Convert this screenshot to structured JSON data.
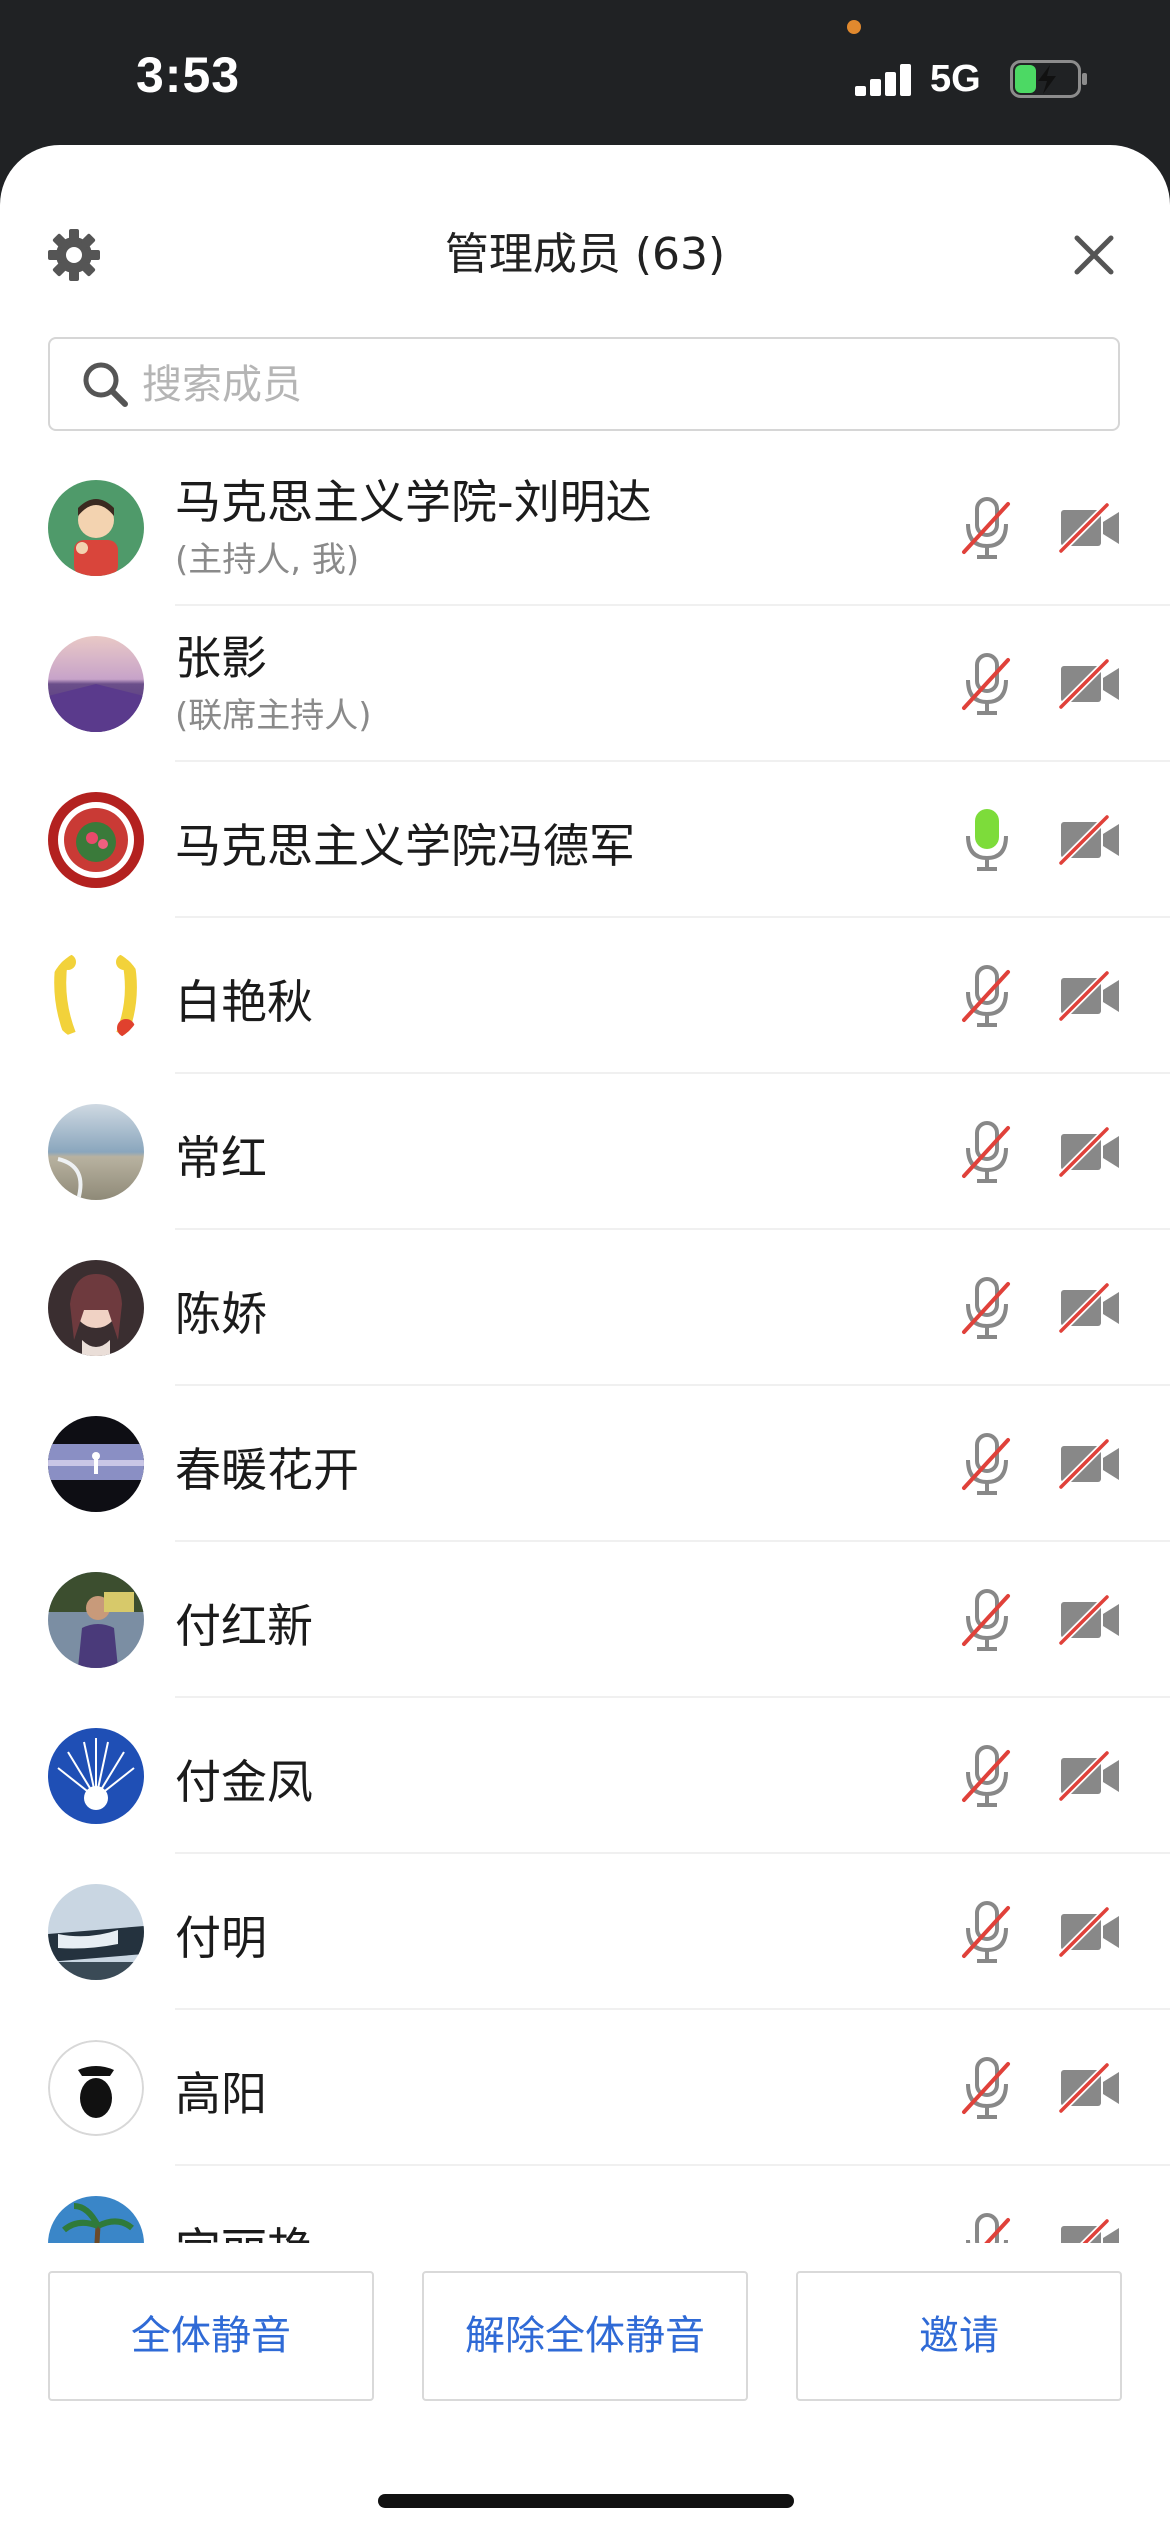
{
  "status_bar": {
    "time": "3:53",
    "network": "5G",
    "recording_dot_color": "#e0892e",
    "battery_level": 0.35,
    "battery_charging": true
  },
  "header": {
    "title": "管理成员 (63)",
    "settings_icon": "gear-icon",
    "close_icon": "close-icon"
  },
  "search": {
    "placeholder": "搜索成员",
    "value": ""
  },
  "members": [
    {
      "name": "马克思主义学院-刘明达",
      "role": "(主持人, 我)",
      "mic": "muted",
      "camera": "off",
      "avatar": "cartoon-man"
    },
    {
      "name": "张影",
      "role": "(联席主持人)",
      "mic": "muted",
      "camera": "off",
      "avatar": "lavender-field"
    },
    {
      "name": "马克思主义学院冯德军",
      "role": "",
      "mic": "active",
      "camera": "off",
      "avatar": "red-seal"
    },
    {
      "name": "白艳秋",
      "role": "",
      "mic": "muted",
      "camera": "off",
      "avatar": "yellow-cartoon"
    },
    {
      "name": "常红",
      "role": "",
      "mic": "muted",
      "camera": "off",
      "avatar": "beach"
    },
    {
      "name": "陈娇",
      "role": "",
      "mic": "muted",
      "camera": "off",
      "avatar": "portrait-woman"
    },
    {
      "name": "春暖花开",
      "role": "",
      "mic": "muted",
      "camera": "off",
      "avatar": "stage"
    },
    {
      "name": "付红新",
      "role": "",
      "mic": "muted",
      "camera": "off",
      "avatar": "outdoor-person"
    },
    {
      "name": "付金凤",
      "role": "",
      "mic": "muted",
      "camera": "off",
      "avatar": "white-peacock"
    },
    {
      "name": "付明",
      "role": "",
      "mic": "muted",
      "camera": "off",
      "avatar": "waterfall"
    },
    {
      "name": "高阳",
      "role": "",
      "mic": "muted",
      "camera": "off",
      "avatar": "black-figure"
    },
    {
      "name": "宫丽艳",
      "role": "",
      "mic": "muted",
      "camera": "off",
      "avatar": "palm-tree"
    }
  ],
  "colors": {
    "accent": "#2f6ad6",
    "mic_active": "#7ddc3a",
    "muted_slash": "#e0413a",
    "icon_gray": "#888888"
  },
  "actions": {
    "mute_all": "全体静音",
    "unmute_all": "解除全体静音",
    "invite": "邀请"
  }
}
